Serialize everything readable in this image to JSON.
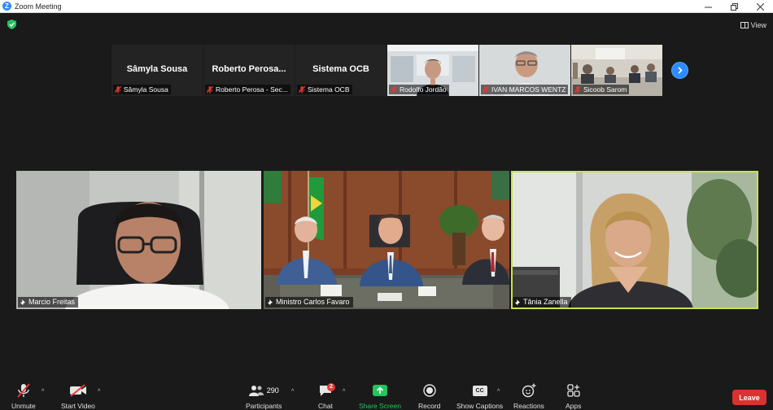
{
  "window": {
    "title": "Zoom Meeting",
    "logo_letter": "Z"
  },
  "top": {
    "view_label": "View"
  },
  "strip": [
    {
      "name_display": "Sâmyla Sousa",
      "label": "Sâmyla Sousa",
      "video": false
    },
    {
      "name_display": "Roberto  Perosa...",
      "label": "Roberto Perosa - Sec...",
      "video": false
    },
    {
      "name_display": "Sistema OCB",
      "label": "Sistema OCB",
      "video": false
    },
    {
      "label": "Rodolfo Jordão",
      "video": true
    },
    {
      "label": "IVAN MARCOS WENTZ",
      "video": true
    },
    {
      "label": "Sicoob Sarom",
      "video": true
    }
  ],
  "main": [
    {
      "label": "Marcio Freitas"
    },
    {
      "label": "Ministro Carlos Favaro"
    },
    {
      "label": "Tânia Zanella"
    }
  ],
  "toolbar": {
    "unmute": "Unmute",
    "start_video": "Start Video",
    "participants": "Participants",
    "participants_count": "290",
    "chat": "Chat",
    "chat_badge": "2",
    "share_screen": "Share Screen",
    "record": "Record",
    "show_captions": "Show Captions",
    "cc_icon_text": "CC",
    "reactions": "Reactions",
    "apps": "Apps",
    "leave": "Leave"
  },
  "colors": {
    "background": "#1a1a1a",
    "accent_blue": "#2d8cff",
    "share_green": "#23c55e",
    "leave_red": "#d9322f",
    "active_speaker": "#c9e34a",
    "muted_red": "#e53935"
  }
}
